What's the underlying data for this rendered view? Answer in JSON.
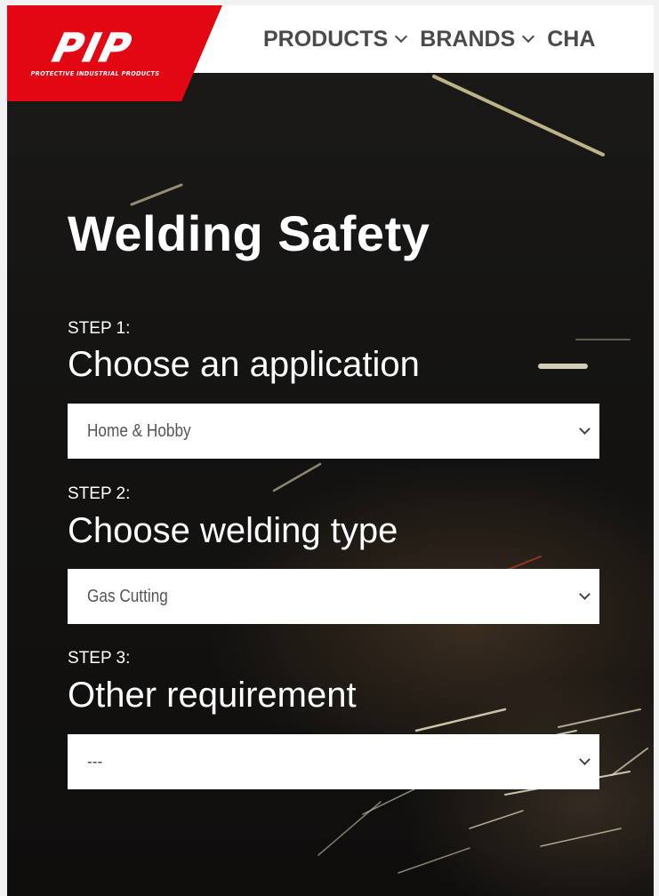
{
  "brand": {
    "logo_text": "PIP",
    "tagline": "PROTECTIVE INDUSTRIAL PRODUCTS",
    "color": "#e30613"
  },
  "nav": {
    "items": [
      {
        "label": "PRODUCTS",
        "icon": "chevron-down-icon"
      },
      {
        "label": "BRANDS",
        "icon": "chevron-down-icon"
      },
      {
        "label": "CHA"
      }
    ]
  },
  "page": {
    "title": "Welding Safety"
  },
  "steps": [
    {
      "step": "STEP 1:",
      "heading": "Choose an application",
      "selected": "Home & Hobby"
    },
    {
      "step": "STEP 2:",
      "heading": "Choose welding type",
      "selected": "Gas Cutting"
    },
    {
      "step": "STEP 3:",
      "heading": "Other requirement",
      "selected": "---"
    }
  ]
}
